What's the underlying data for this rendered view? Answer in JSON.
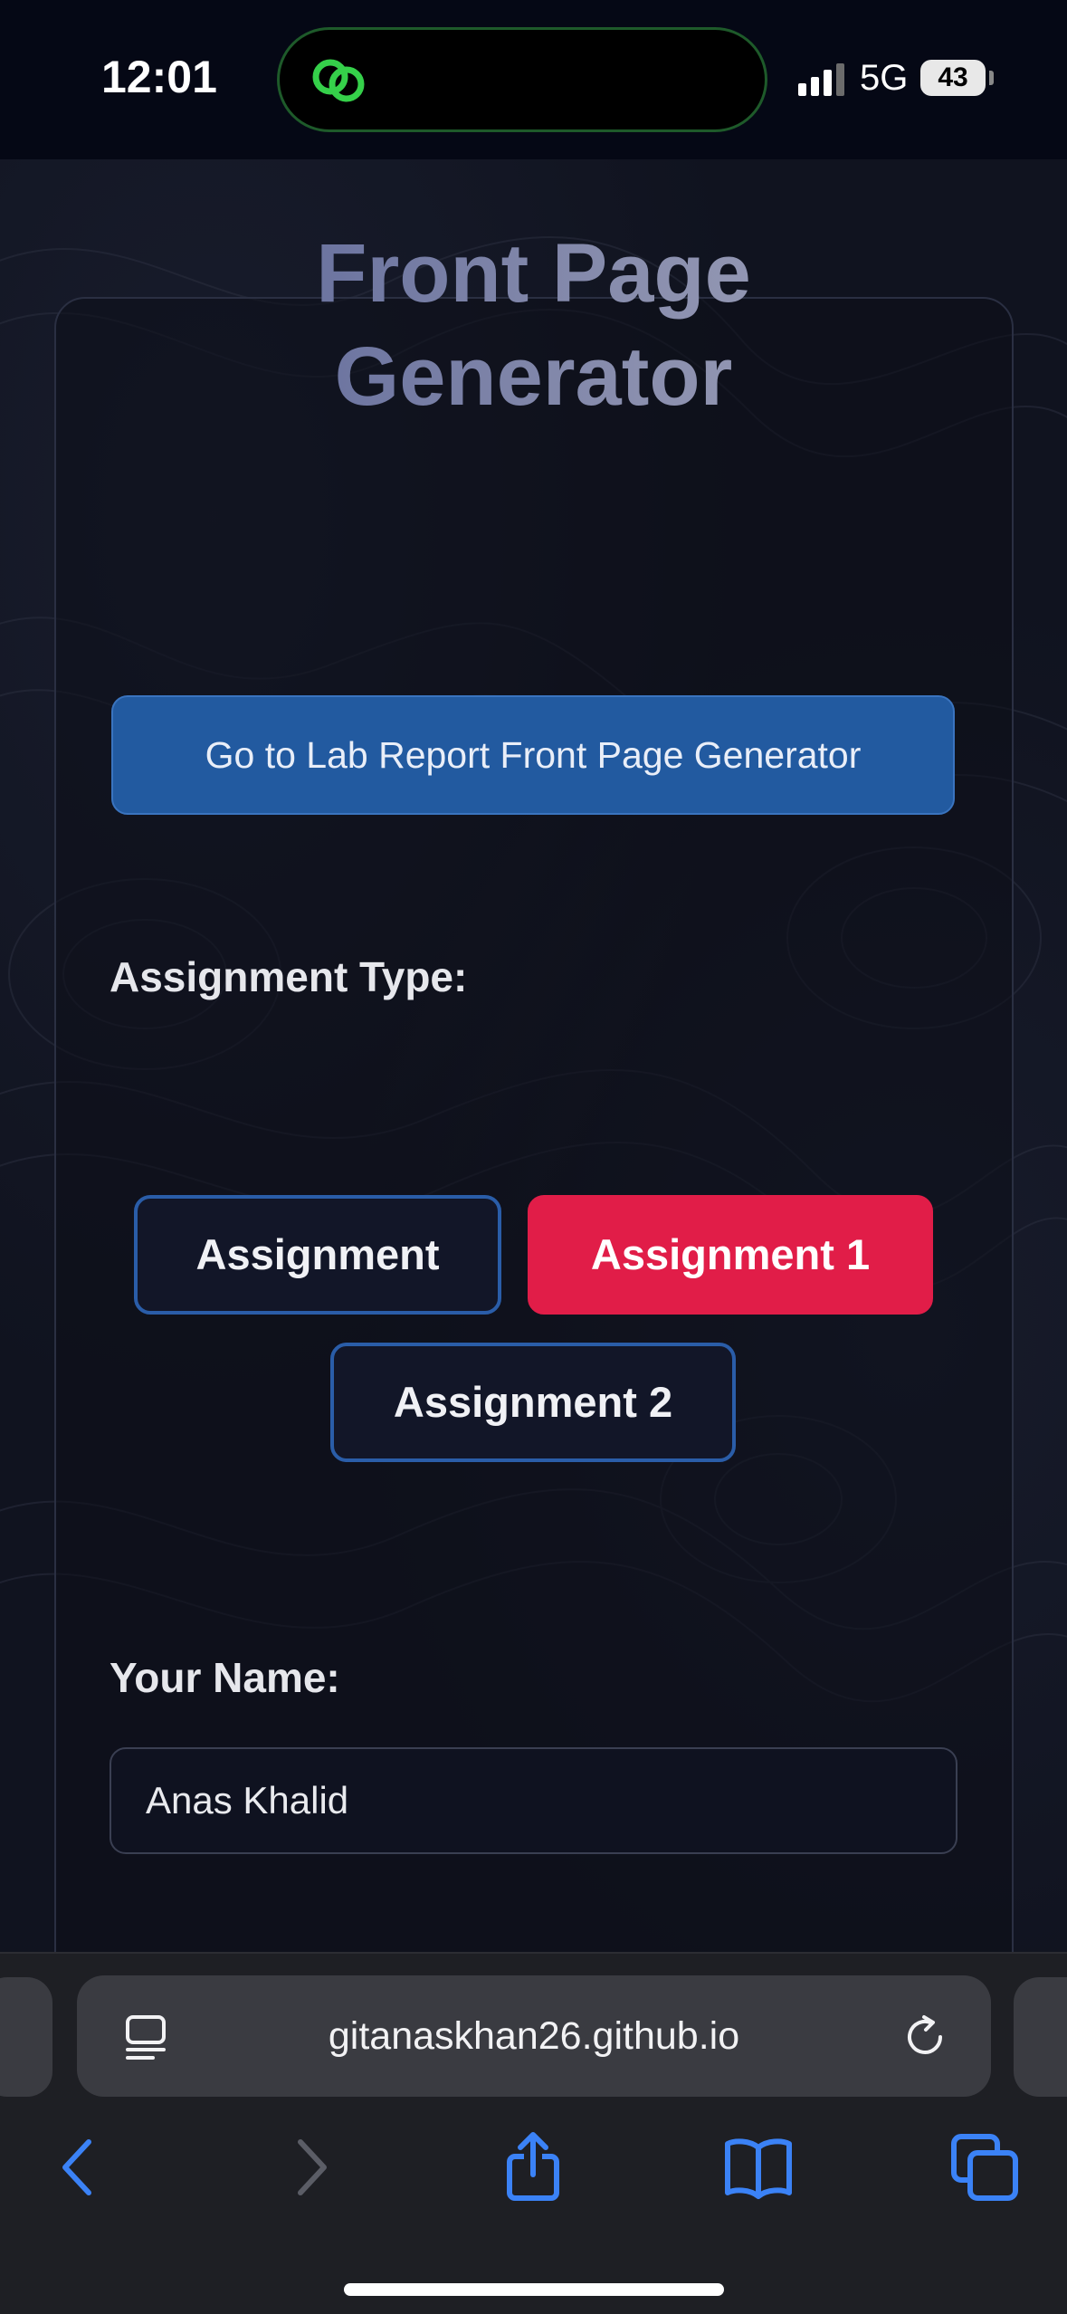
{
  "status_bar": {
    "time": "12:01",
    "network": "5G",
    "battery": "43"
  },
  "page": {
    "title_line1": "Front Page",
    "title_line2": "Generator",
    "lab_button": "Go to Lab Report Front Page Generator",
    "assignment_type_label": "Assignment Type:",
    "options": [
      {
        "label": "Assignment",
        "selected": false
      },
      {
        "label": "Assignment 1",
        "selected": true
      },
      {
        "label": "Assignment 2",
        "selected": false
      }
    ],
    "name_label": "Your Name:",
    "name_value": "Anas Khalid"
  },
  "browser": {
    "url": "gitanaskhan26.github.io"
  },
  "colors": {
    "accent_blue": "#225aa0",
    "selected_red": "#e11d48",
    "island_icon_green": "#35d04a"
  },
  "icons": [
    "linked-rings-icon",
    "signal-icon",
    "battery-icon",
    "reader-mode-icon",
    "reload-icon",
    "back-icon",
    "forward-icon",
    "share-icon",
    "bookmarks-icon",
    "tabs-icon"
  ]
}
